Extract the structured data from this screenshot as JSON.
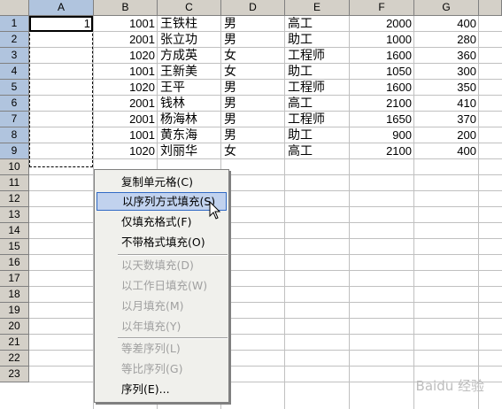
{
  "columns": [
    "A",
    "B",
    "C",
    "D",
    "E",
    "F",
    "G"
  ],
  "rows": [
    "1",
    "2",
    "3",
    "4",
    "5",
    "6",
    "7",
    "8",
    "9",
    "10",
    "11",
    "12",
    "13",
    "14",
    "15",
    "16",
    "17",
    "18",
    "19",
    "20",
    "21",
    "22",
    "23"
  ],
  "cells": [
    {
      "a": "1",
      "b": "1001",
      "c": "王铁柱",
      "d": "男",
      "e": "高工",
      "f": "2000",
      "g": "400"
    },
    {
      "a": "",
      "b": "2001",
      "c": "张立功",
      "d": "男",
      "e": "助工",
      "f": "1000",
      "g": "280"
    },
    {
      "a": "",
      "b": "1020",
      "c": "方成英",
      "d": "女",
      "e": "工程师",
      "f": "1600",
      "g": "360"
    },
    {
      "a": "",
      "b": "1001",
      "c": "王新美",
      "d": "女",
      "e": "助工",
      "f": "1050",
      "g": "300"
    },
    {
      "a": "",
      "b": "1020",
      "c": "王平",
      "d": "男",
      "e": "工程师",
      "f": "1600",
      "g": "350"
    },
    {
      "a": "",
      "b": "2001",
      "c": "钱林",
      "d": "男",
      "e": "高工",
      "f": "2100",
      "g": "410"
    },
    {
      "a": "",
      "b": "2001",
      "c": "杨海林",
      "d": "男",
      "e": "工程师",
      "f": "1650",
      "g": "370"
    },
    {
      "a": "",
      "b": "1001",
      "c": "黄东海",
      "d": "男",
      "e": "助工",
      "f": "900",
      "g": "200"
    },
    {
      "a": "",
      "b": "1020",
      "c": "刘丽华",
      "d": "女",
      "e": "高工",
      "f": "2100",
      "g": "400"
    }
  ],
  "menu": {
    "items": [
      {
        "label": "复制单元格(C)",
        "disabled": false
      },
      {
        "label": "以序列方式填充(S)",
        "disabled": false,
        "hover": true
      },
      {
        "label": "仅填充格式(F)",
        "disabled": false
      },
      {
        "label": "不带格式填充(O)",
        "disabled": false
      },
      {
        "label": "以天数填充(D)",
        "disabled": true
      },
      {
        "label": "以工作日填充(W)",
        "disabled": true
      },
      {
        "label": "以月填充(M)",
        "disabled": true
      },
      {
        "label": "以年填充(Y)",
        "disabled": true
      },
      {
        "label": "等差序列(L)",
        "disabled": true
      },
      {
        "label": "等比序列(G)",
        "disabled": true
      },
      {
        "label": "序列(E)...",
        "disabled": false
      }
    ]
  },
  "watermark": "Baidu 经验"
}
